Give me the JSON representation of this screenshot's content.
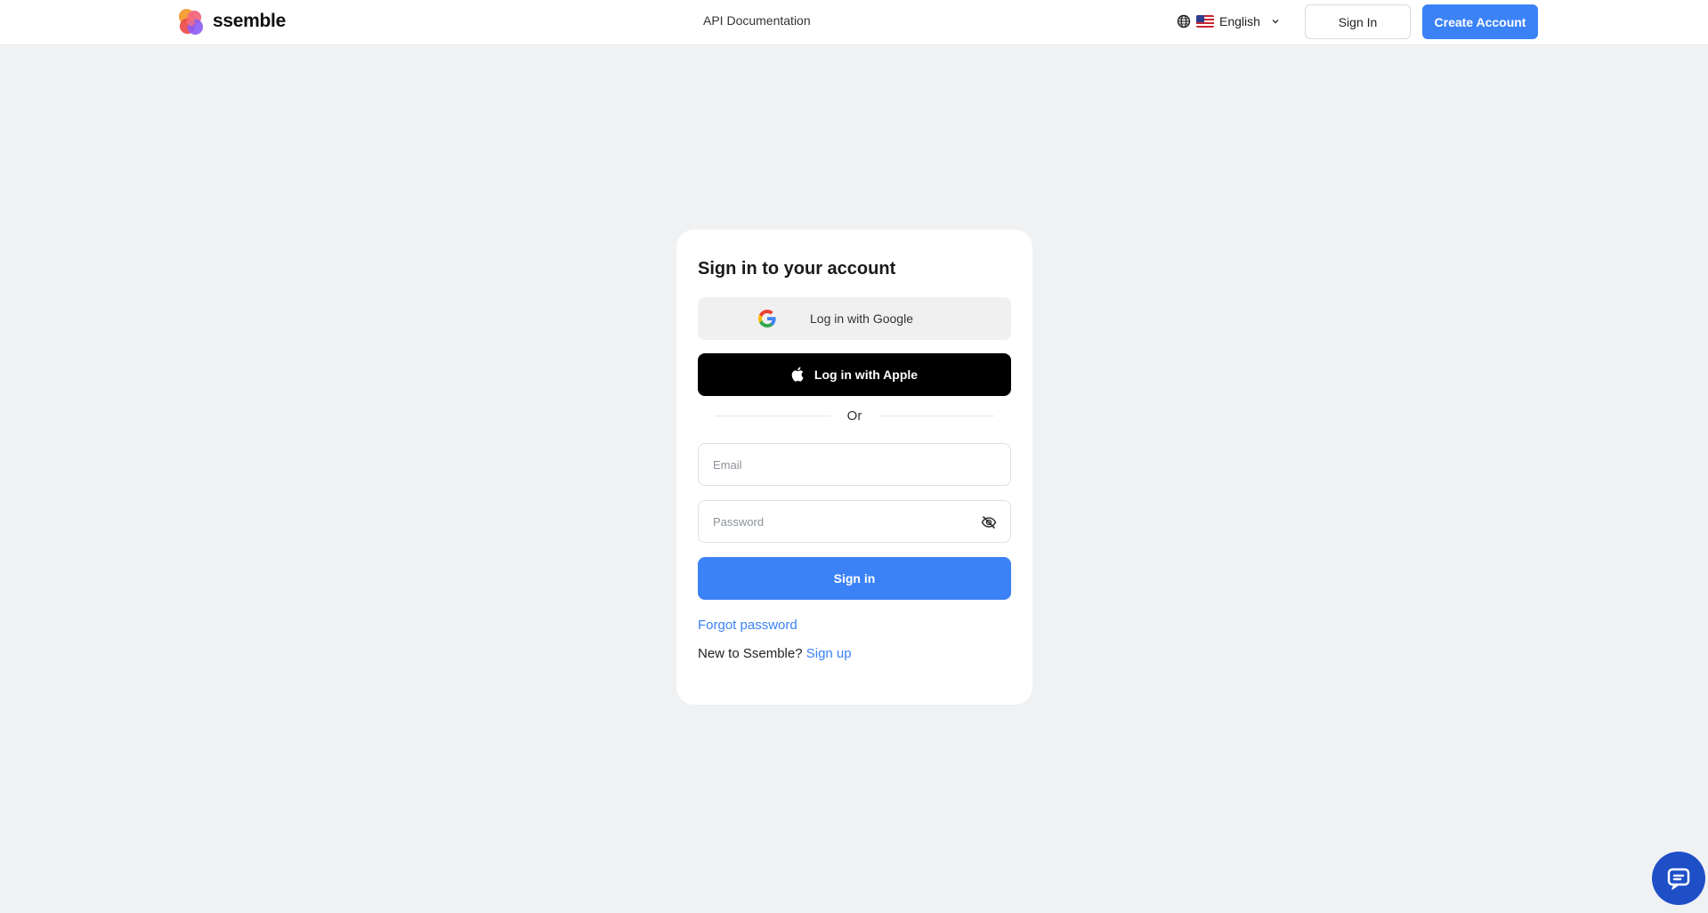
{
  "header": {
    "brand": "ssemble",
    "nav_api_docs": "API Documentation",
    "language": "English",
    "language_flag_icon": "us-flag-icon",
    "sign_in_label": "Sign In",
    "create_account_label": "Create Account"
  },
  "login": {
    "title": "Sign in to your account",
    "google_label": "Log in with Google",
    "apple_label": "Log in with Apple",
    "divider_text": "Or",
    "email_placeholder": "Email",
    "password_placeholder": "Password",
    "submit_label": "Sign in",
    "forgot_label": "Forgot password",
    "new_user_text": "New to Ssemble?",
    "signup_label": "Sign up"
  },
  "colors": {
    "accent": "#3b82f6",
    "background": "#f0f1f3",
    "chat": "#1e4fc7"
  },
  "icons": {
    "language": "globe-icon",
    "dropdown": "chevron-down-icon",
    "google": "google-icon",
    "apple": "apple-icon",
    "password_toggle": "eye-off-icon",
    "chat": "chat-icon"
  }
}
